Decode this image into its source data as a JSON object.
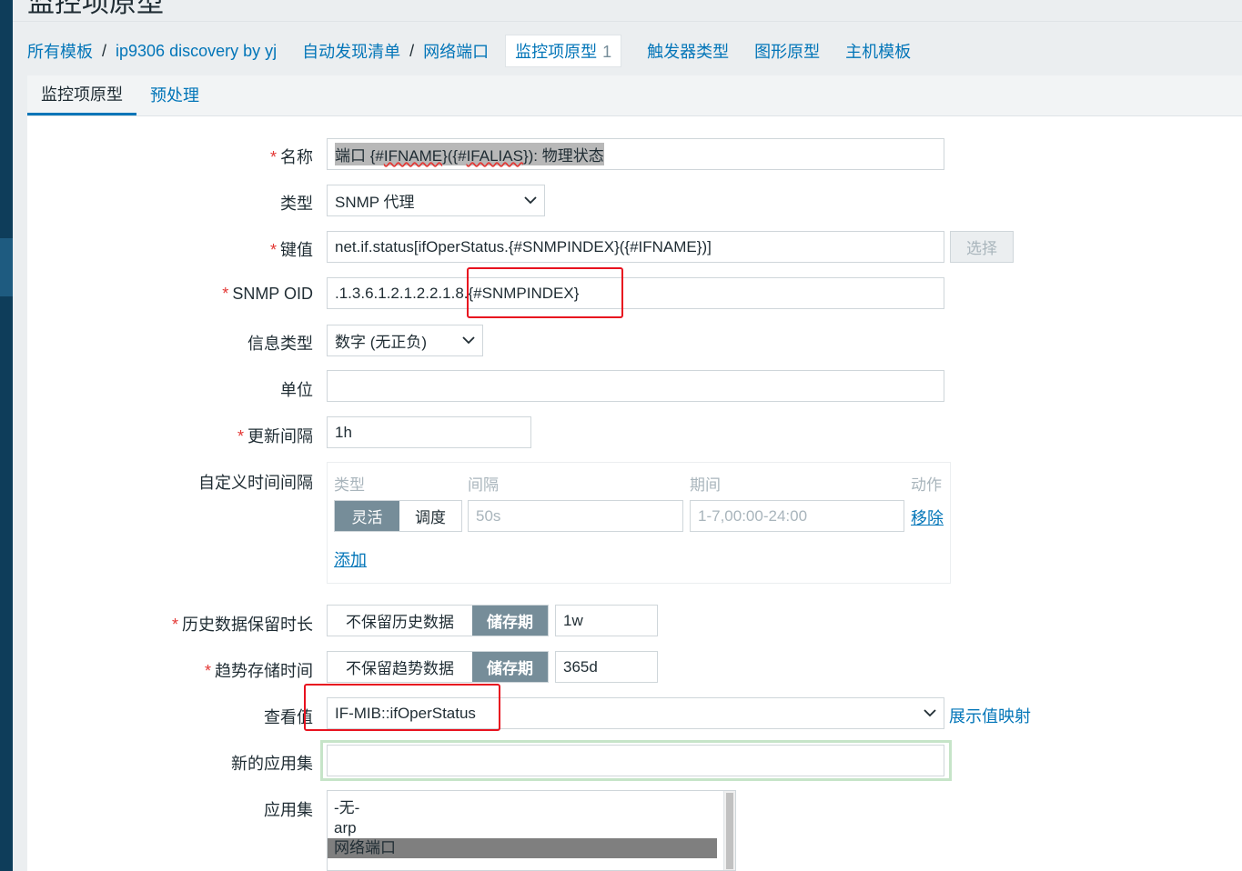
{
  "page": {
    "top_title": "监控项原型"
  },
  "breadcrumb": {
    "items": [
      "所有模板",
      "ip9306 discovery by yj",
      "自动发现清单",
      "网络端口"
    ],
    "separator": "/"
  },
  "nav_tabs": [
    {
      "label": "监控项原型",
      "count": "1",
      "active": true
    },
    {
      "label": "触发器类型"
    },
    {
      "label": "图形原型"
    },
    {
      "label": "主机模板"
    }
  ],
  "subtabs": [
    {
      "label": "监控项原型",
      "active": true
    },
    {
      "label": "预处理"
    }
  ],
  "form": {
    "required_mark": "*",
    "name": {
      "label": "名称",
      "prefix": "端口 {#",
      "part1": "IFNAME",
      "mid": "}({#",
      "part2": "IFALIAS",
      "suffix": "}): 物理状态"
    },
    "type": {
      "label": "类型",
      "value": "SNMP 代理"
    },
    "key": {
      "label": "键值",
      "value": "net.if.status[ifOperStatus.{#SNMPINDEX}({#IFNAME})]",
      "button": "选择"
    },
    "snmp_oid": {
      "label": "SNMP OID",
      "value": ".1.3.6.1.2.1.2.2.1.8.{#SNMPINDEX}"
    },
    "info_type": {
      "label": "信息类型",
      "value": "数字 (无正负)"
    },
    "unit": {
      "label": "单位",
      "value": ""
    },
    "update_interval": {
      "label": "更新间隔",
      "value": "1h"
    },
    "custom_intervals": {
      "label": "自定义时间间隔",
      "headers": {
        "type": "类型",
        "interval": "间隔",
        "period": "期间",
        "action": "动作"
      },
      "seg_flexible": "灵活",
      "seg_scheduling": "调度",
      "interval_placeholder": "50s",
      "period_placeholder": "1-7,00:00-24:00",
      "remove": "移除",
      "add": "添加"
    },
    "history": {
      "label": "历史数据保留时长",
      "opt_none": "不保留历史数据",
      "opt_store": "储存期",
      "value": "1w"
    },
    "trends": {
      "label": "趋势存储时间",
      "opt_none": "不保留趋势数据",
      "opt_store": "储存期",
      "value": "365d"
    },
    "valuemap": {
      "label": "查看值",
      "value": "IF-MIB::ifOperStatus",
      "link": "展示值映射"
    },
    "new_application": {
      "label": "新的应用集",
      "value": ""
    },
    "applications": {
      "label": "应用集",
      "options": [
        "-无-",
        "arp",
        "网络端口"
      ],
      "selected_index": 2
    }
  },
  "colors": {
    "accent": "#0275b8",
    "required": "#e33734",
    "annotation": "#e8121f",
    "segment_on": "#768d99"
  }
}
